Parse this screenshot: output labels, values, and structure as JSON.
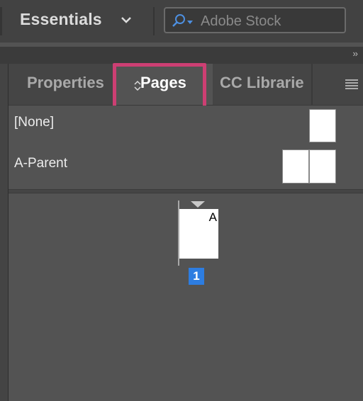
{
  "topbar": {
    "workspace_name": "Essentials",
    "search_placeholder": "Adobe Stock"
  },
  "strip": {
    "collapse_label": "››"
  },
  "tabs": [
    {
      "label": "Properties",
      "active": false
    },
    {
      "label": "Pages",
      "active": true
    },
    {
      "label": "CC Librarie",
      "active": false
    }
  ],
  "parents": [
    {
      "label": "[None]"
    },
    {
      "label": "A-Parent"
    }
  ],
  "page": {
    "prefix": "A",
    "number": "1"
  },
  "colors": {
    "highlight": "#cd3f73",
    "selected_page": "#2d7de1"
  }
}
